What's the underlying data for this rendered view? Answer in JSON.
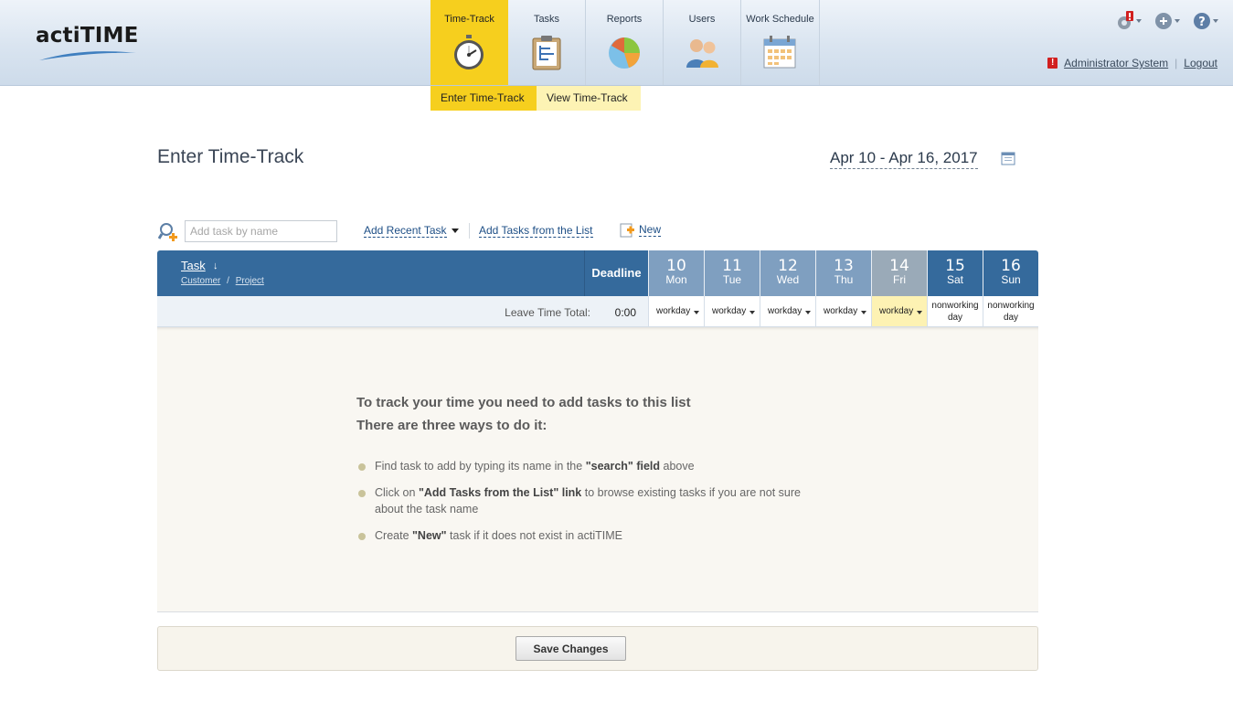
{
  "app": {
    "logo": "actiTIME"
  },
  "nav": {
    "tabs": [
      {
        "label": "Time-Track",
        "icon": "stopwatch-icon",
        "active": true
      },
      {
        "label": "Tasks",
        "icon": "clipboard-icon",
        "active": false
      },
      {
        "label": "Reports",
        "icon": "pie-chart-icon",
        "active": false
      },
      {
        "label": "Users",
        "icon": "users-icon",
        "active": false
      },
      {
        "label": "Work Schedule",
        "icon": "calendar-icon",
        "active": false
      }
    ],
    "subtabs": [
      {
        "label": "Enter Time-Track",
        "active": true
      },
      {
        "label": "View Time-Track",
        "active": false
      }
    ]
  },
  "header": {
    "icons": [
      "settings-alert-icon",
      "add-icon",
      "help-icon"
    ],
    "user_name": "Administrator System",
    "logout_label": "Logout",
    "separator": "|"
  },
  "page": {
    "title": "Enter Time-Track",
    "week_range": "Apr 10 - Apr 16, 2017"
  },
  "toolbar": {
    "search_placeholder": "Add task by name",
    "add_recent_label": "Add Recent Task",
    "add_from_list_label": "Add Tasks from the List",
    "new_label": "New"
  },
  "grid": {
    "task_header": "Task",
    "sort_arrow": "↓",
    "customer_label": "Customer",
    "slash": "/",
    "project_label": "Project",
    "deadline_header": "Deadline",
    "days": [
      {
        "num": "10",
        "name": "Mon",
        "type": "workday",
        "today": false,
        "weekend": false
      },
      {
        "num": "11",
        "name": "Tue",
        "type": "workday",
        "today": false,
        "weekend": false
      },
      {
        "num": "12",
        "name": "Wed",
        "type": "workday",
        "today": false,
        "weekend": false
      },
      {
        "num": "13",
        "name": "Thu",
        "type": "workday",
        "today": false,
        "weekend": false
      },
      {
        "num": "14",
        "name": "Fri",
        "type": "workday",
        "today": true,
        "weekend": false
      },
      {
        "num": "15",
        "name": "Sat",
        "type": "nonworking day",
        "today": false,
        "weekend": true
      },
      {
        "num": "16",
        "name": "Sun",
        "type": "nonworking day",
        "today": false,
        "weekend": true
      }
    ],
    "leave_label": "Leave Time Total:",
    "leave_value": "0:00"
  },
  "empty_state": {
    "title_line1": "To track your time you need to add tasks to this list",
    "title_line2": "There are three ways to do it:",
    "items": [
      {
        "pre": "Find task to add by typing its name in the ",
        "bold": "\"search\" field",
        "post": " above"
      },
      {
        "pre": "Click on ",
        "bold": "\"Add Tasks from the List\" link",
        "post": " to browse existing tasks if you are not sure about the task name"
      },
      {
        "pre": "Create ",
        "bold": "\"New\"",
        "post": " task if it does not exist in actiTIME"
      }
    ]
  },
  "footer": {
    "save_label": "Save Changes"
  },
  "colors": {
    "accent_yellow": "#f6cf1e",
    "header_blue": "#356a9c",
    "day_blue": "#7f9fc0",
    "today_gray": "#9aaab8",
    "link_blue": "#1e4f86",
    "alert_red": "#d11f1f"
  }
}
